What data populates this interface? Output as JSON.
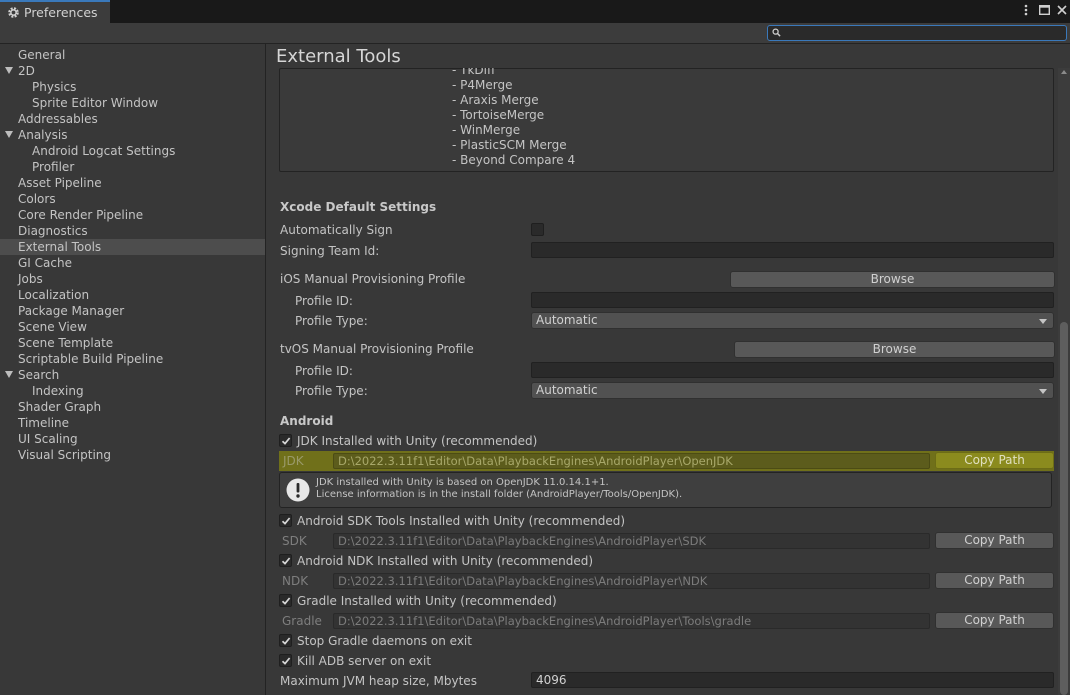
{
  "window": {
    "tab_title": "Preferences"
  },
  "search": {
    "placeholder": ""
  },
  "sidebar": {
    "items": [
      {
        "label": "General",
        "indent": 0
      },
      {
        "label": "2D",
        "indent": 0,
        "expanded": true
      },
      {
        "label": "Physics",
        "indent": 1
      },
      {
        "label": "Sprite Editor Window",
        "indent": 1
      },
      {
        "label": "Addressables",
        "indent": 0
      },
      {
        "label": "Analysis",
        "indent": 0,
        "expanded": true
      },
      {
        "label": "Android Logcat Settings",
        "indent": 1
      },
      {
        "label": "Profiler",
        "indent": 1
      },
      {
        "label": "Asset Pipeline",
        "indent": 0
      },
      {
        "label": "Colors",
        "indent": 0
      },
      {
        "label": "Core Render Pipeline",
        "indent": 0
      },
      {
        "label": "Diagnostics",
        "indent": 0
      },
      {
        "label": "External Tools",
        "indent": 0,
        "selected": true
      },
      {
        "label": "GI Cache",
        "indent": 0
      },
      {
        "label": "Jobs",
        "indent": 0
      },
      {
        "label": "Localization",
        "indent": 0
      },
      {
        "label": "Package Manager",
        "indent": 0
      },
      {
        "label": "Scene View",
        "indent": 0
      },
      {
        "label": "Scene Template",
        "indent": 0
      },
      {
        "label": "Scriptable Build Pipeline",
        "indent": 0
      },
      {
        "label": "Search",
        "indent": 0,
        "expanded": true
      },
      {
        "label": "Indexing",
        "indent": 1
      },
      {
        "label": "Shader Graph",
        "indent": 0
      },
      {
        "label": "Timeline",
        "indent": 0
      },
      {
        "label": "UI Scaling",
        "indent": 0
      },
      {
        "label": "Visual Scripting",
        "indent": 0
      }
    ]
  },
  "main": {
    "title": "External Tools",
    "diff_tools": [
      "- TkDiff",
      "- P4Merge",
      "- Araxis Merge",
      "- TortoiseMerge",
      "- WinMerge",
      "- PlasticSCM Merge",
      "- Beyond Compare 4"
    ],
    "xcode": {
      "heading": "Xcode Default Settings",
      "auto_sign": "Automatically Sign",
      "signing_team": "Signing Team Id:",
      "ios_profile": "iOS Manual Provisioning Profile",
      "tvos_profile": "tvOS Manual Provisioning Profile",
      "browse": "Browse",
      "profile_id": "Profile ID:",
      "profile_type": "Profile Type:",
      "profile_type_value": "Automatic"
    },
    "android": {
      "heading": "Android",
      "jdk_check": "JDK Installed with Unity (recommended)",
      "jdk_label": "JDK",
      "jdk_path": "D:\\2022.3.11f1\\Editor\\Data\\PlaybackEngines\\AndroidPlayer\\OpenJDK",
      "copy_path": "Copy Path",
      "help_line1": "JDK installed with Unity is based on OpenJDK 11.0.14.1+1.",
      "help_line2": "License information is in the install folder (AndroidPlayer/Tools/OpenJDK).",
      "sdk_check": "Android SDK Tools Installed with Unity (recommended)",
      "sdk_label": "SDK",
      "sdk_path": "D:\\2022.3.11f1\\Editor\\Data\\PlaybackEngines\\AndroidPlayer\\SDK",
      "ndk_check": "Android NDK Installed with Unity (recommended)",
      "ndk_label": "NDK",
      "ndk_path": "D:\\2022.3.11f1\\Editor\\Data\\PlaybackEngines\\AndroidPlayer\\NDK",
      "gradle_check": "Gradle Installed with Unity (recommended)",
      "gradle_label": "Gradle",
      "gradle_path": "D:\\2022.3.11f1\\Editor\\Data\\PlaybackEngines\\AndroidPlayer\\Tools\\gradle",
      "stop_gradle": "Stop Gradle daemons on exit",
      "kill_adb": "Kill ADB server on exit",
      "jvm_heap": "Maximum JVM heap size, Mbytes",
      "jvm_heap_value": "4096"
    }
  }
}
